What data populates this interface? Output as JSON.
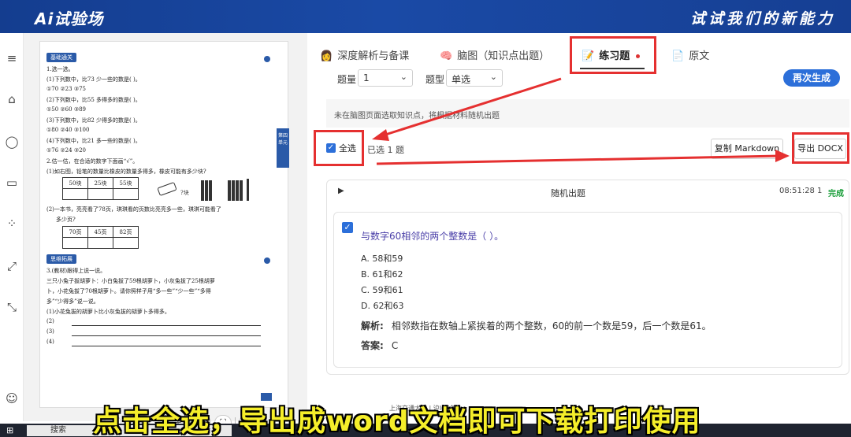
{
  "app": {
    "logo": "Ai试验场",
    "slogan": "试试我们的新能力"
  },
  "rail": {
    "items": [
      {
        "name": "menu-icon",
        "glyph": "≡"
      },
      {
        "name": "home-icon",
        "glyph": "⌂"
      },
      {
        "name": "chat-icon",
        "glyph": "◯"
      },
      {
        "name": "panel-icon",
        "glyph": "▭"
      },
      {
        "name": "apps-icon",
        "glyph": "⁘"
      },
      {
        "name": "expand-icon",
        "glyph": "⤢"
      },
      {
        "name": "collapse-icon",
        "glyph": "⤡"
      },
      {
        "name": "user-icon",
        "glyph": "☺"
      }
    ]
  },
  "doc": {
    "section1": "基础通关",
    "section2": "思维拓展",
    "side_tab": "第四单元",
    "lines1": [
      "1.选一选。",
      "(1)下列数中，比73 少一些的数是(        )。",
      "      ①70                  ②23                        ③75",
      "(2)下列数中，比55 多得多的数是(        )。",
      "      ①50                  ②60                        ③89",
      "(3)下列数中，比82 少得多的数是(        )。",
      "      ①80                  ②40                        ③100",
      "(4)下列数中，比21 多一些的数是(        )。",
      "      ①76                  ②24                        ③20",
      "2.估一估，在合适的数字下面画“√”。",
      "(1)如右图，铅笔的数量比橡皮的数量多得多，橡皮可能有多少块?"
    ],
    "table1": [
      "50块",
      "25块",
      "55块"
    ],
    "q2b": "(2)一本书，亮亮看了78页，琪琪看的页数比亮亮多一些，琪琪可能看了",
    "q2b_2": "多少页?",
    "table2": [
      "70页",
      "45页",
      "82页"
    ],
    "lines2": [
      "3.(教材)跟得上说一说。",
      "三只小兔子拔胡萝卜：小白兔拔了59根胡萝卜，小灰兔拔了25根胡萝",
      "卜，小花兔拔了70根胡萝卜。请你照样子用“多一些”“少一些”“多得",
      "多”“少得多”说一说。",
      "(1)小花兔拔的胡萝卜比小灰兔拔的胡萝卜多得多。",
      "(2)",
      "(3)",
      "(4)"
    ],
    "toolbar": [
      "‹",
      "›",
      "−",
      "+",
      "⟷",
      "⛶",
      "⤢"
    ]
  },
  "tabs": [
    {
      "label": "深度解析与备课",
      "icon": "👩"
    },
    {
      "label": "脑图（知识点出题）",
      "icon": "🧠"
    },
    {
      "label": "练习题",
      "icon": "📝"
    },
    {
      "label": "原文",
      "icon": "📄"
    }
  ],
  "settings": {
    "count_label": "题量",
    "count_value": "1",
    "type_label": "题型",
    "type_value": "单选",
    "regen": "再次生成"
  },
  "notice": "未在脑图页面选取知识点，将根据材料随机出题",
  "actions": {
    "select_all": "全选",
    "selected": "已选 1 题",
    "copy_md": "复制 Markdown",
    "export_docx": "导出 DOCX"
  },
  "question": {
    "source": "随机出题",
    "time": "08:51:28",
    "count": "1",
    "status": "完成",
    "stem": "与数字60相邻的两个整数是（ ）。",
    "options": [
      "A. 58和59",
      "B. 61和62",
      "C. 59和61",
      "D. 62和63"
    ],
    "analysis_label": "解析:",
    "analysis": "相邻数指在数轴上紧挨着的两个整数，60的前一个数是59，后一个数是61。",
    "answer_label": "答案:",
    "answer": "C"
  },
  "footer": "上海交通大学 | 沪ICP备",
  "subtitle": "点击全选，导出成word文档即可下载打印使用",
  "taskbar": {
    "start": "⊞",
    "search": "搜索"
  },
  "colors": {
    "banner": "#1a4aa6",
    "accent": "#2c6fd9",
    "annotation": "#e53030",
    "subtitle": "#f5ee2a"
  }
}
